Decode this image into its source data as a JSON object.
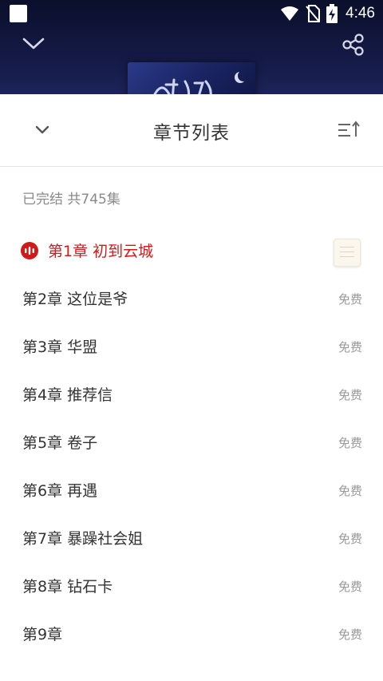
{
  "status_bar": {
    "time": "4:46",
    "icons": [
      "app-notification-icon",
      "wifi-icon",
      "no-sim-icon",
      "battery-charging-icon"
    ]
  },
  "header": {
    "back_icon": "chevron-down-icon",
    "share_icon": "share-icon"
  },
  "sheet": {
    "title": "章节列表",
    "collapse_icon": "chevron-down-icon",
    "sort_icon": "sort-order-icon",
    "summary": "已完结 共745集"
  },
  "chapters": [
    {
      "title": "第1章 初到云城",
      "badge": "",
      "current": true
    },
    {
      "title": "第2章 这位是爷",
      "badge": "免费"
    },
    {
      "title": "第3章 华盟",
      "badge": "免费"
    },
    {
      "title": "第4章 推荐信",
      "badge": "免费"
    },
    {
      "title": "第5章 卷子",
      "badge": "免费"
    },
    {
      "title": "第6章 再遇",
      "badge": "免费"
    },
    {
      "title": "第7章 暴躁社会姐",
      "badge": "免费"
    },
    {
      "title": "第8章 钻石卡",
      "badge": "免费"
    },
    {
      "title": "第9章",
      "badge": "免费"
    }
  ],
  "colors": {
    "accent_red": "#d01a1a",
    "header_bg": "#141a45",
    "muted_text": "#9a9a9a"
  }
}
